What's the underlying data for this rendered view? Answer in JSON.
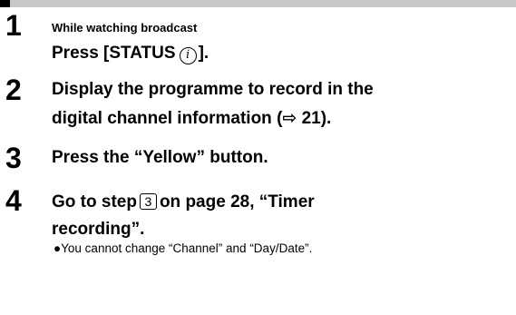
{
  "steps": [
    {
      "number": "1",
      "context": "While watching broadcast",
      "line_prefix": "Press [STATUS",
      "icon": "info-icon",
      "icon_glyph": "i",
      "line_suffix": "]."
    },
    {
      "number": "2",
      "line1": "Display the programme to record in the",
      "line2": "digital channel information (⇨ 21)."
    },
    {
      "number": "3",
      "line1": "Press the “Yellow” button."
    },
    {
      "number": "4",
      "line1_prefix": "Go to step",
      "boxed_step": "3",
      "line1_suffix": "on page 28, “Timer",
      "line2": "recording”.",
      "note": "●You cannot change “Channel” and “Day/Date”."
    }
  ]
}
